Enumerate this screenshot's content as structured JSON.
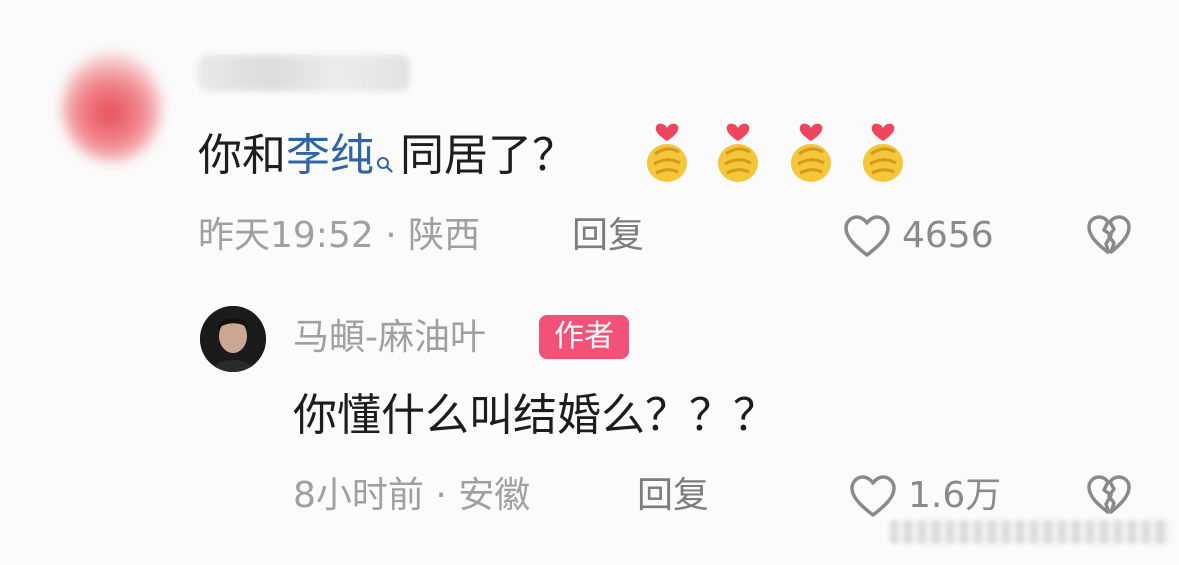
{
  "top_comment": {
    "text_before": "你和",
    "mention": "李纯",
    "text_after": "同居了？",
    "emoji_count": 4,
    "time": "昨天19:52",
    "location": "陕西",
    "reply_label": "回复",
    "like_count": "4656"
  },
  "reply_comment": {
    "username": "马頔-麻油叶",
    "badge": "作者",
    "text": "你懂什么叫结婚么？？？",
    "time": "8小时前",
    "location": "安徽",
    "reply_label": "回复",
    "like_count": "1.6万"
  },
  "colors": {
    "mention": "#2f64a6",
    "author_badge": "#f25278"
  },
  "icons": {
    "search": "search-icon",
    "like": "heart-outline-icon",
    "dislike": "broken-heart-icon",
    "emoji": "finger-heart-emoji-icon"
  }
}
